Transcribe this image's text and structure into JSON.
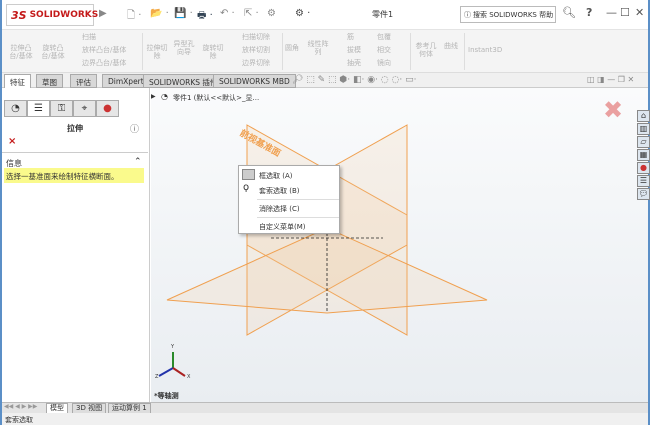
{
  "titlebar": {
    "logo_brand": "SOLIDWORKS",
    "doc_title": "零件1",
    "search_placeholder": "搜索 SOLIDWORKS 帮助",
    "help": "?",
    "minimize": "—",
    "maximize": "☐",
    "close": "✕"
  },
  "ribbon": {
    "items": [
      "拉伸凸台/基体",
      "旋转凸台/基体",
      "扫描",
      "放样凸台/基体",
      "边界凸台/基体",
      "拉伸切除",
      "异型孔向导",
      "旋转切除",
      "扫描切除",
      "放样切割",
      "边界切除",
      "圆角",
      "线性阵列",
      "筋",
      "拔模",
      "抽壳",
      "包覆",
      "相交",
      "镜向",
      "参考几何体",
      "曲线",
      "Instant3D"
    ]
  },
  "tabs": [
    "特征",
    "草图",
    "评估",
    "DimXpert",
    "SOLIDWORKS 插件",
    "SOLIDWORKS MBD"
  ],
  "panel": {
    "title": "拉伸",
    "help": "?",
    "cancel": "×",
    "info_header": "信息",
    "info_text": "选择一基准面来绘制特征横断面。"
  },
  "viewport": {
    "tree_item": "零件1 (默认<<默认>_显...",
    "plane_label": "前视基准面",
    "view_label": "*等轴测",
    "axes": {
      "x": "X",
      "y": "Y",
      "z": "Z"
    }
  },
  "context_menu": [
    "框选取 (A)",
    "套索选取 (B)",
    "消除选择 (C)",
    "自定义菜单(M)"
  ],
  "bottom_tabs": [
    "模型",
    "3D 视图",
    "运动算例 1"
  ],
  "status": "套索选取",
  "colors": {
    "plane": "#f0a050",
    "accent": "#c41a1a",
    "info_bg": "#fafa8c"
  }
}
